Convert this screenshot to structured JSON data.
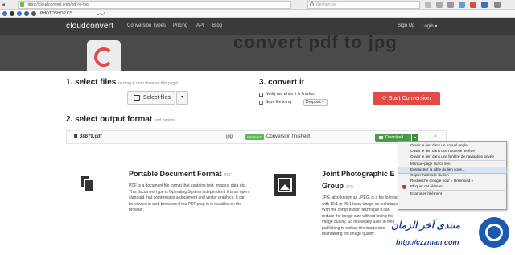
{
  "browser": {
    "url": "https://cloudconvert.com/pdf-to-jpg",
    "search_placeholder": "Rechercher",
    "bookmark1": "PHOTOSHOP CS...",
    "bookmark2": "عربي"
  },
  "site": {
    "logo": "cloudconvert",
    "nav": [
      "Conversion Types",
      "Pricing",
      "API",
      "Blog"
    ],
    "signup": "Sign Up",
    "login": "Login ▾",
    "hero_title": "convert pdf to jpg"
  },
  "step1": {
    "title": "1. select files",
    "subtitle": "or drag & drop them on this page!",
    "select_label": "Select files",
    "caret": "▾"
  },
  "step3": {
    "title": "3. convert it",
    "notify_label": "Notify me when it is finished",
    "save_label": "Save file to my",
    "save_target": "Dropbox ▾",
    "start_label": "Start Conversion"
  },
  "step2": {
    "title": "2. select output format",
    "subtitle": "and options"
  },
  "file": {
    "name": "38879.pdf",
    "format": "jpg",
    "badge": "FINISHED",
    "status": "Conversion finished!",
    "download_label": "Download",
    "close": "×"
  },
  "pdf_info": {
    "title": "Portable Document Format",
    "tag": "PDF",
    "body": "PDF is a document file format that contains text, images, data etc. This document type is Operating System independent. It is an open standard that compresses a document and vector graphics. It can be viewed in web browsers if the PDF plug-in is installed on the browser."
  },
  "jpg_info": {
    "title_line1": "Joint Photographic E",
    "title_line2": "Group",
    "tag": "JPG",
    "body": "JPG, also known as JPEG, is a file fo image with 10:1 to 20:1 lossy image co technique. With the compression technique it can reduce the image size without losing the image quality. So it is widely used in web publishing to reduce the image size maintaining the image quality."
  },
  "context_menu": {
    "items": [
      "Ouvrir le lien dans un nouvel onglet",
      "Ouvrir le lien dans une nouvelle fenêtre",
      "Ouvrir le lien dans une fenêtre de navigation privée",
      "Marque-page sur ce lien",
      "Enregistrer la cible du lien sous...",
      "Copier l'adresse du lien",
      "Recherche Google pour « Download »",
      "Bloquer cet élément",
      "Examiner l'élément"
    ],
    "highlighted_index": 4
  },
  "watermark": {
    "arabic": "منتدى آخر الزمان",
    "url": "http://czzman.com"
  },
  "colors": {
    "header_bg": "#3a3a3a",
    "start_button": "#e14a46",
    "download_button": "#4a9a4a",
    "finished_badge": "#5cb85c"
  }
}
